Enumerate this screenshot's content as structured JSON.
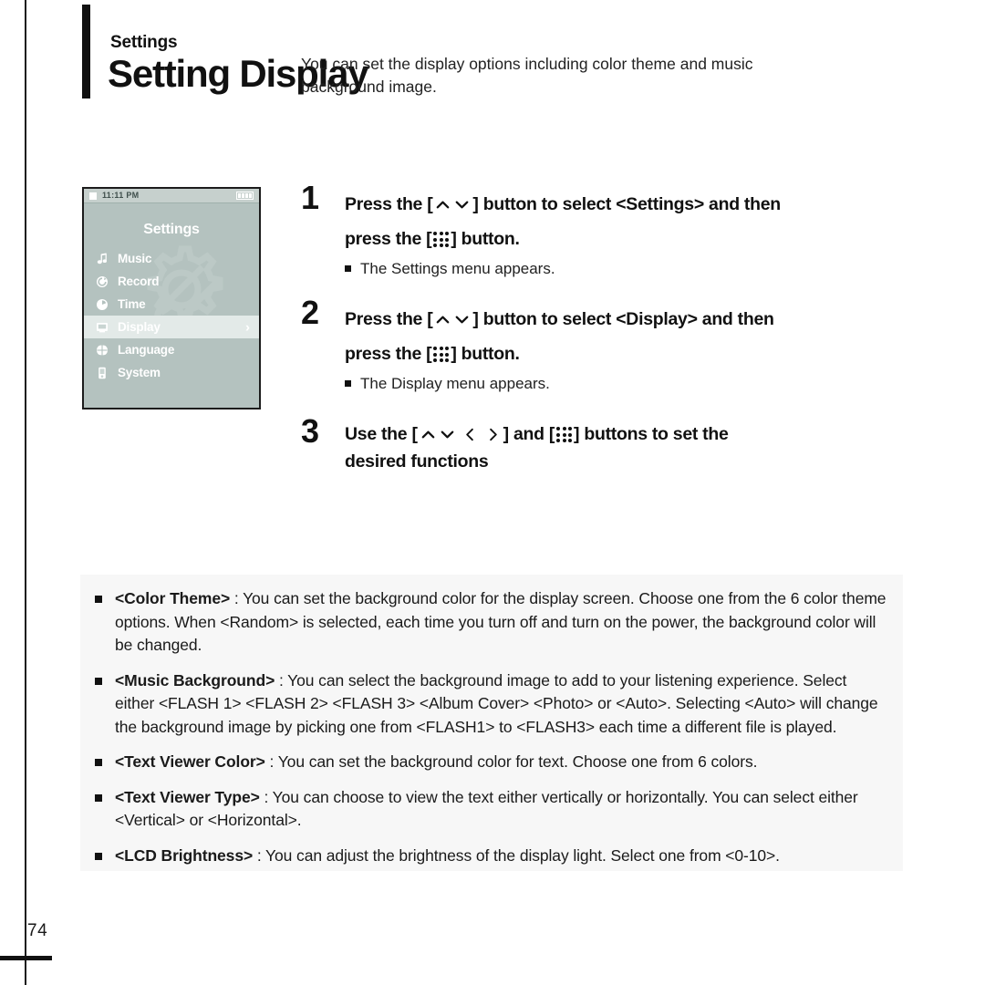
{
  "page": {
    "number": "74"
  },
  "header": {
    "kicker": "Settings",
    "title": "Setting Display",
    "description": "You can set the display options including color theme and music background image."
  },
  "device": {
    "status": {
      "time": "11:11 PM",
      "stop_icon": "stop-square-icon",
      "battery_icon": "battery-full-icon"
    },
    "screen_title": "Settings",
    "watermark_icon": "gear-wrench-watermark",
    "menu": [
      {
        "label": "Music",
        "icon": "music-note-icon",
        "selected": false,
        "arrow": ""
      },
      {
        "label": "Record",
        "icon": "record-loop-icon",
        "selected": false,
        "arrow": ""
      },
      {
        "label": "Time",
        "icon": "clock-icon",
        "selected": false,
        "arrow": ""
      },
      {
        "label": "Display",
        "icon": "monitor-icon",
        "selected": true,
        "arrow": "›"
      },
      {
        "label": "Language",
        "icon": "globe-icon",
        "selected": false,
        "arrow": ""
      },
      {
        "label": "System",
        "icon": "device-icon",
        "selected": false,
        "arrow": ""
      }
    ]
  },
  "steps": [
    {
      "number": "1",
      "line1_a": "Press the [",
      "line1_b": "] button to select <Settings> and then",
      "line2_a": "press the [",
      "line2_b": "] button.",
      "note": "The Settings menu appears."
    },
    {
      "number": "2",
      "line1_a": "Press the [",
      "line1_b": "] button to select <Display> and then",
      "line2_a": "press the [",
      "line2_b": "] button.",
      "note": "The Display menu appears."
    },
    {
      "number": "3",
      "line1_a": "Use the [",
      "line1_b": "] and [",
      "line1_c": "] buttons to set the",
      "line2": "desired functions",
      "note": ""
    }
  ],
  "notes": [
    {
      "term": "<Color Theme>",
      "body": " : You can set the background color for the display screen. Choose one from the 6 color theme options. When <Random> is selected, each time you turn off and turn on the power, the background color will be changed."
    },
    {
      "term": "<Music Background>",
      "body": " : You can select the background image to add to your listening experience. Select either <FLASH 1> <FLASH 2> <FLASH 3> <Album Cover> <Photo> or <Auto>. Selecting <Auto> will change the background image by picking one from <FLASH1> to <FLASH3> each time a different file is played."
    },
    {
      "term": "<Text Viewer Color>",
      "body": " : You can set the background color for text. Choose one from 6 colors."
    },
    {
      "term": "<Text Viewer Type>",
      "body": " : You can choose to view the text either vertically or horizontally. You can select either <Vertical> or <Horizontal>."
    },
    {
      "term": "<LCD Brightness>",
      "body": " : You can adjust the brightness of the display light. Select one from <0-10>."
    }
  ],
  "colors": {
    "device_bg": "#b4c2bf",
    "device_statusbar": "#c6d0cd",
    "device_selected_row": "#e3eae8",
    "notes_panel": "#f7f7f7",
    "ink": "#111111"
  }
}
